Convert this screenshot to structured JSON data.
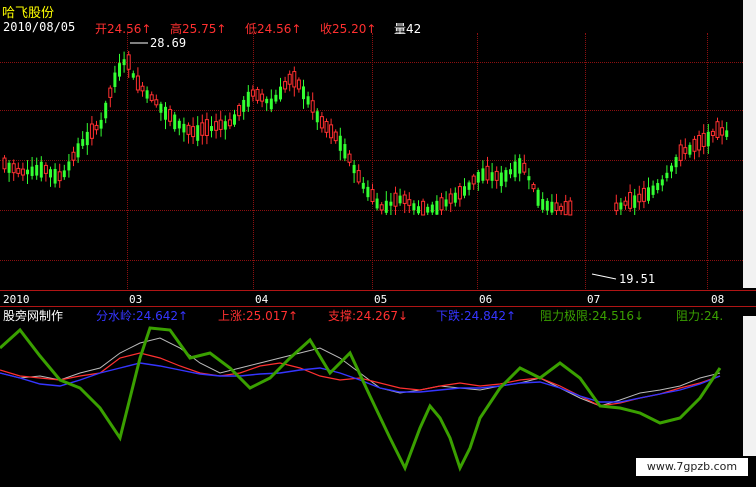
{
  "stock": {
    "name": "哈飞股份",
    "date": "2010/08/05",
    "open_label": "开24.56↑",
    "high_label": "高25.75↑",
    "low_label": "低24.56↑",
    "close_label": "收25.20↑",
    "vol_label": "量42"
  },
  "price_marks": {
    "max": "28.69",
    "min": "19.51"
  },
  "axis": {
    "labels": [
      "2010",
      "03",
      "04",
      "05",
      "06",
      "07",
      "08"
    ]
  },
  "indicator": {
    "name": "股旁网制作",
    "fenshui": "分水岭:24.642↑",
    "shangzhang": "上涨:25.017↑",
    "zhicheng": "支撑:24.267↓",
    "xiadie": "下跌:24.842↑",
    "zuli_jixian": "阻力极限:24.516↓",
    "zuli": "阻力:24."
  },
  "watermark": "www.7gpzb.com",
  "colors": {
    "up": "#ff3030",
    "down": "#33ff33",
    "grid": "#8b1010",
    "blue": "#3535ff",
    "green_line": "#3aa000",
    "white": "#ffffff",
    "yellow": "#ffff00"
  }
}
